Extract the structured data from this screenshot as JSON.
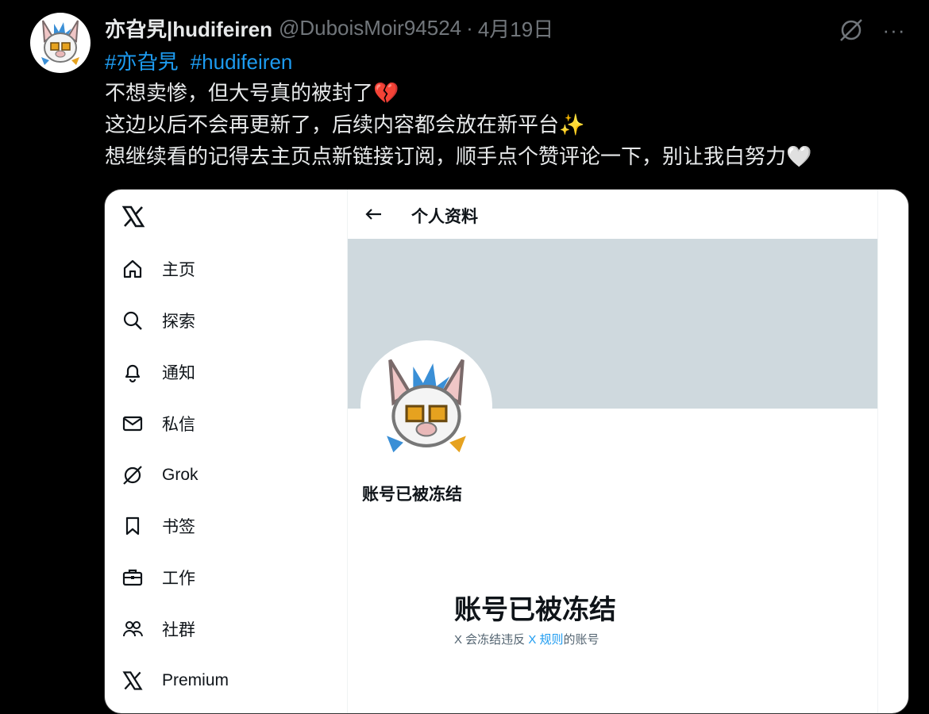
{
  "post": {
    "author_name": "亦旮旯|hudifeiren",
    "author_handle": "@DuboisMoir94524",
    "separator": "·",
    "date": "4月19日",
    "more_label": "···",
    "hashtags": [
      "#亦旮旯",
      "#hudifeiren"
    ],
    "lines": [
      {
        "text": "不想卖惨，但大号真的被封了",
        "emoji": "💔"
      },
      {
        "text": "这边以后不会再更新了，后续内容都会放在新平台",
        "emoji": "✨"
      },
      {
        "text": "想继续看的记得去主页点新链接订阅，顺手点个赞评论一下，别让我白努力",
        "emoji": "🤍"
      }
    ]
  },
  "screenshot": {
    "nav_items": [
      {
        "label": "主页",
        "icon": "home-icon"
      },
      {
        "label": "探索",
        "icon": "search-icon"
      },
      {
        "label": "通知",
        "icon": "bell-icon"
      },
      {
        "label": "私信",
        "icon": "mail-icon"
      },
      {
        "label": "Grok",
        "icon": "grok-icon"
      },
      {
        "label": "书签",
        "icon": "bookmark-icon"
      },
      {
        "label": "工作",
        "icon": "briefcase-icon"
      },
      {
        "label": "社群",
        "icon": "people-icon"
      },
      {
        "label": "Premium",
        "icon": "x-logo-icon"
      }
    ],
    "header_title": "个人资料",
    "account_name": "账号已被冻结",
    "suspended_heading": "账号已被冻结",
    "desc_prefix": "X 会冻结违反 ",
    "desc_link": "X 规则",
    "desc_suffix": "的账号"
  },
  "colors": {
    "background": "#000000",
    "text_primary": "#e7e9ea",
    "text_secondary": "#71767b",
    "link_blue": "#1d9bf0",
    "banner_gray": "#cfd9de"
  }
}
